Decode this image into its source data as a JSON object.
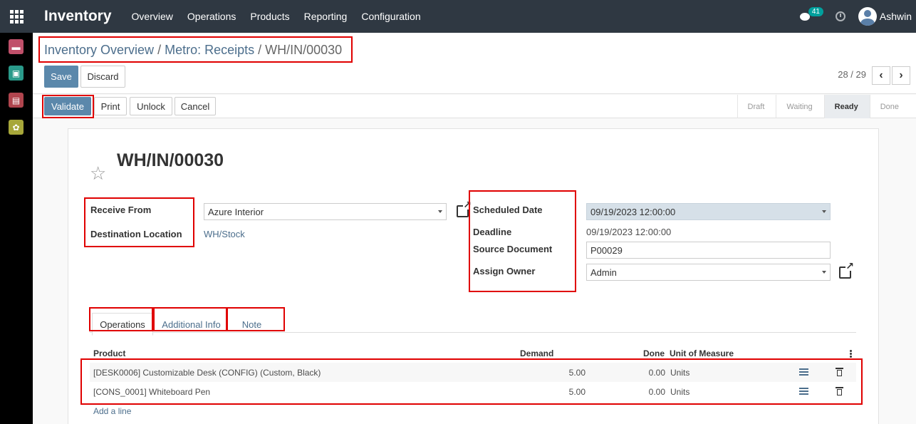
{
  "navbar": {
    "brand": "Inventory",
    "menu": [
      "Overview",
      "Operations",
      "Products",
      "Reporting",
      "Configuration"
    ],
    "chat_badge": "41",
    "user_name": "Ashwin"
  },
  "breadcrumb": {
    "items": [
      "Inventory Overview",
      "Metro: Receipts"
    ],
    "current": "WH/IN/00030"
  },
  "toolbar": {
    "save_label": "Save",
    "discard_label": "Discard"
  },
  "pager": {
    "text": "28 / 29",
    "prev": "‹",
    "next": "›"
  },
  "actions": {
    "validate": "Validate",
    "print": "Print",
    "unlock": "Unlock",
    "cancel": "Cancel"
  },
  "statusbar": {
    "stages": [
      "Draft",
      "Waiting",
      "Ready",
      "Done"
    ],
    "active_stage": "Ready"
  },
  "record": {
    "title": "WH/IN/00030",
    "receive_from_label": "Receive From",
    "receive_from_value": "Azure Interior",
    "destination_label": "Destination Location",
    "destination_value": "WH/Stock",
    "scheduled_date_label": "Scheduled Date",
    "scheduled_date_value": "09/19/2023 12:00:00",
    "deadline_label": "Deadline",
    "deadline_value": "09/19/2023 12:00:00",
    "source_document_label": "Source Document",
    "source_document_value": "P00029",
    "assign_owner_label": "Assign Owner",
    "assign_owner_value": "Admin"
  },
  "tabs": [
    "Operations",
    "Additional Info",
    "Note"
  ],
  "table": {
    "headers": {
      "product": "Product",
      "demand": "Demand",
      "done": "Done",
      "uom": "Unit of Measure"
    },
    "rows": [
      {
        "product": "[DESK0006] Customizable Desk (CONFIG) (Custom, Black)",
        "demand": "5.00",
        "done": "0.00",
        "uom": "Units"
      },
      {
        "product": "[CONS_0001] Whiteboard Pen",
        "demand": "5.00",
        "done": "0.00",
        "uom": "Units"
      }
    ],
    "add_line": "Add a line"
  },
  "colors": {
    "navbar": "#2f3842",
    "primary": "#5b88ab",
    "link": "#4c6e8c",
    "annotation": "#e00000"
  }
}
